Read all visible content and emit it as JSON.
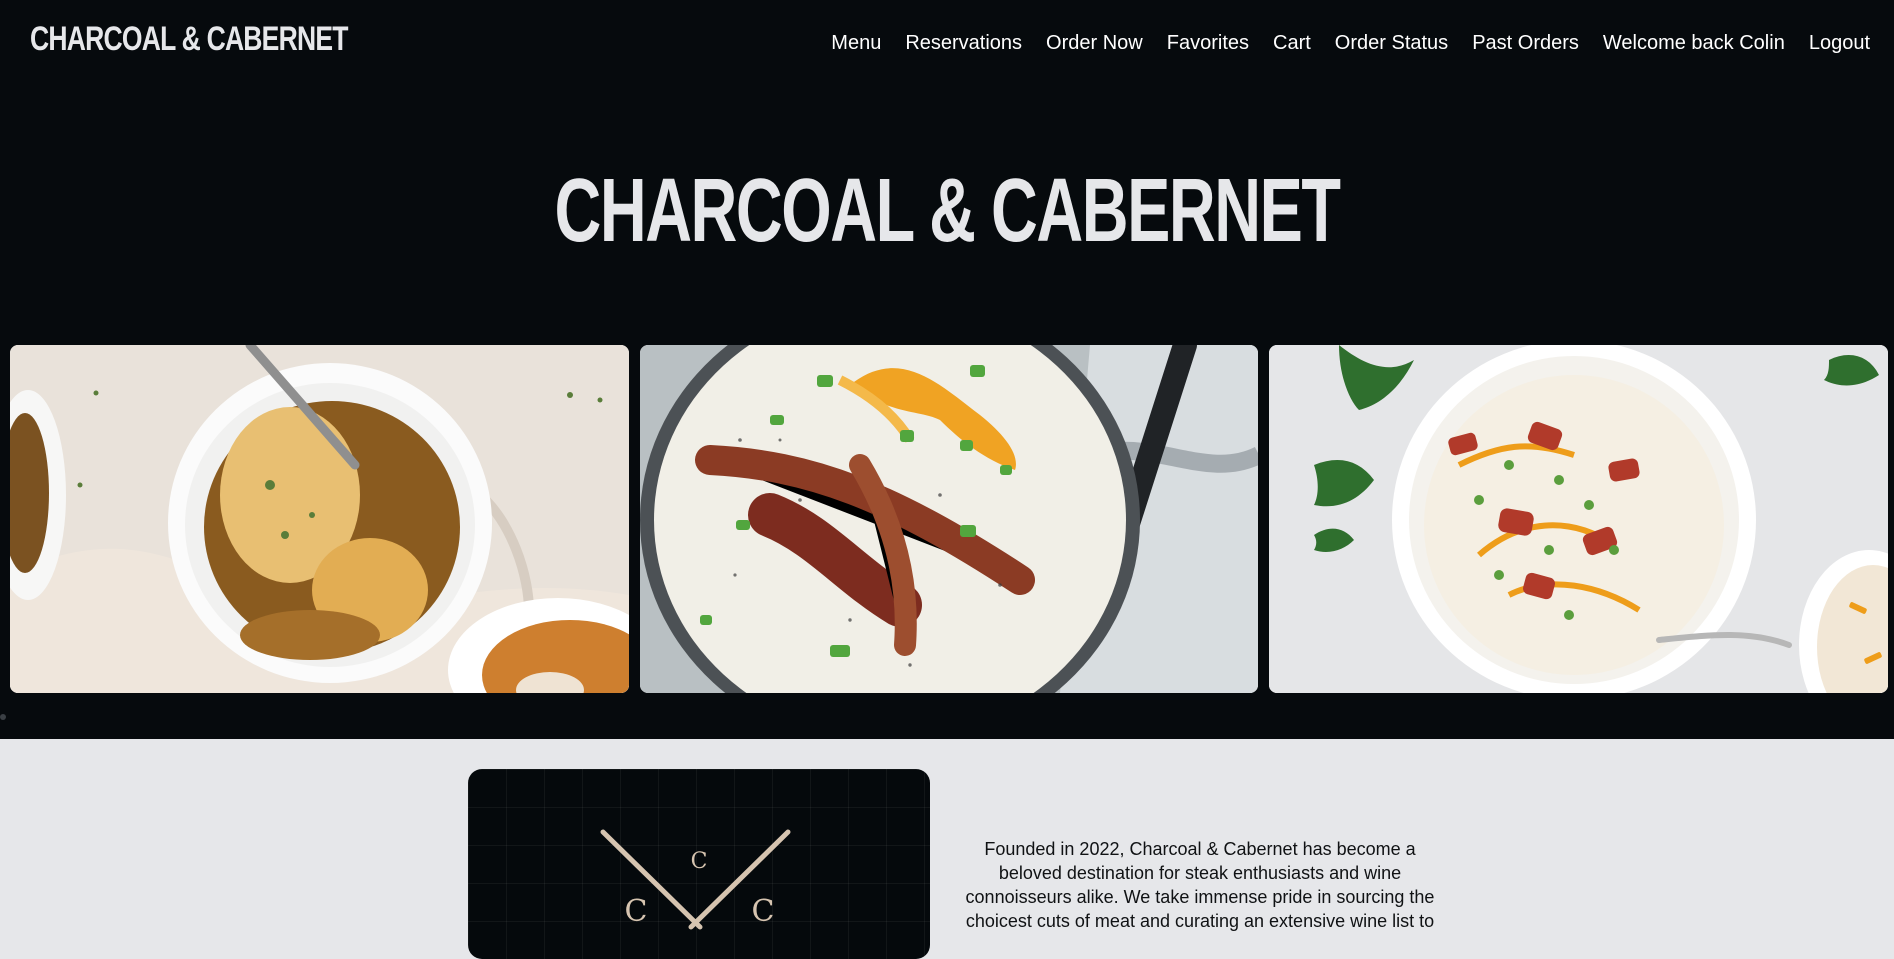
{
  "header": {
    "brand": "CHARCOAL & CABERNET",
    "nav": [
      {
        "label": "Menu"
      },
      {
        "label": "Reservations"
      },
      {
        "label": "Order Now"
      },
      {
        "label": "Favorites"
      },
      {
        "label": "Cart"
      },
      {
        "label": "Order Status"
      },
      {
        "label": "Past Orders"
      },
      {
        "label": "Welcome back Colin"
      },
      {
        "label": "Logout"
      }
    ]
  },
  "hero": {
    "title": "CHARCOAL & CABERNET",
    "gallery": [
      {
        "dish": "french-onion-soup"
      },
      {
        "dish": "loaded-potato-soup-pot"
      },
      {
        "dish": "loaded-potato-soup-bowl"
      }
    ]
  },
  "about": {
    "logo_letter_top": "C",
    "logo_letter_left": "C",
    "logo_letter_right": "C",
    "text": "Founded in 2022, Charcoal & Cabernet has become a beloved destination for steak enthusiasts and wine connoisseurs alike. We take immense pride in sourcing the choicest cuts of meat and curating an extensive wine list to"
  },
  "colors": {
    "header_bg": "#060a0d",
    "page_bg": "#e6e7ea",
    "text_light": "#ffffff",
    "logo_gold": "#d6c4b0"
  }
}
